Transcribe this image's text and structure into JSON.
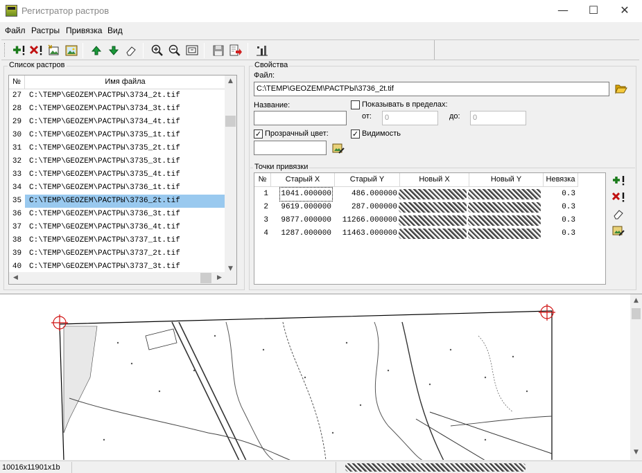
{
  "window": {
    "title": "Регистратор растров",
    "minimize_glyph": "—",
    "maximize_glyph": "☐",
    "close_glyph": "✕"
  },
  "menu": [
    "Файл",
    "Растры",
    "Привязка",
    "Вид"
  ],
  "toolbar": {
    "buttons": [
      {
        "name": "add-raster",
        "icon": "plus-exclaim-icon",
        "color": "#1a7a1a"
      },
      {
        "name": "remove-raster",
        "icon": "x-exclaim-icon",
        "color": "#c01010"
      },
      {
        "name": "open-raster",
        "icon": "image-open-icon"
      },
      {
        "name": "raster-image",
        "icon": "picture-icon"
      },
      {
        "name": "move-up",
        "icon": "arrow-up-icon",
        "color": "#1a9a3a"
      },
      {
        "name": "move-down",
        "icon": "arrow-down-icon",
        "color": "#1a9a3a"
      },
      {
        "name": "eraser",
        "icon": "eraser-icon"
      },
      {
        "name": "zoom-in",
        "icon": "zoom-in-icon"
      },
      {
        "name": "zoom-out",
        "icon": "zoom-out-icon"
      },
      {
        "name": "zoom-fit",
        "icon": "zoom-fit-icon"
      },
      {
        "name": "save",
        "icon": "floppy-icon"
      },
      {
        "name": "export",
        "icon": "export-icon",
        "color": "#d02020"
      },
      {
        "name": "tools",
        "icon": "tools-icon"
      }
    ]
  },
  "raster_list": {
    "group_label": "Список растров",
    "col_num": "№",
    "col_file": "Имя файла",
    "selected_index": 8,
    "rows": [
      {
        "num": "27",
        "file": "C:\\TEMP\\GEOZEM\\РАСТРЫ\\3734_2t.tif"
      },
      {
        "num": "28",
        "file": "C:\\TEMP\\GEOZEM\\РАСТРЫ\\3734_3t.tif"
      },
      {
        "num": "29",
        "file": "C:\\TEMP\\GEOZEM\\РАСТРЫ\\3734_4t.tif"
      },
      {
        "num": "30",
        "file": "C:\\TEMP\\GEOZEM\\РАСТРЫ\\3735_1t.tif"
      },
      {
        "num": "31",
        "file": "C:\\TEMP\\GEOZEM\\РАСТРЫ\\3735_2t.tif"
      },
      {
        "num": "32",
        "file": "C:\\TEMP\\GEOZEM\\РАСТРЫ\\3735_3t.tif"
      },
      {
        "num": "33",
        "file": "C:\\TEMP\\GEOZEM\\РАСТРЫ\\3735_4t.tif"
      },
      {
        "num": "34",
        "file": "C:\\TEMP\\GEOZEM\\РАСТРЫ\\3736_1t.tif"
      },
      {
        "num": "35",
        "file": "C:\\TEMP\\GEOZEM\\РАСТРЫ\\3736_2t.tif"
      },
      {
        "num": "36",
        "file": "C:\\TEMP\\GEOZEM\\РАСТРЫ\\3736_3t.tif"
      },
      {
        "num": "37",
        "file": "C:\\TEMP\\GEOZEM\\РАСТРЫ\\3736_4t.tif"
      },
      {
        "num": "38",
        "file": "C:\\TEMP\\GEOZEM\\РАСТРЫ\\3737_1t.tif"
      },
      {
        "num": "39",
        "file": "C:\\TEMP\\GEOZEM\\РАСТРЫ\\3737_2t.tif"
      },
      {
        "num": "40",
        "file": "C:\\TEMP\\GEOZEM\\РАСТРЫ\\3737_3t.tif"
      }
    ],
    "selection_color": "#99c9ef"
  },
  "properties": {
    "group_label": "Свойства",
    "file_label": "Файл:",
    "file_value": "C:\\TEMP\\GEOZEM\\РАСТРЫ\\3736_2t.tif",
    "name_label": "Название:",
    "name_value": "",
    "show_within_label": "Показывать в пределах:",
    "show_within_checked": false,
    "from_label": "от:",
    "from_value": "0",
    "to_label": "до:",
    "to_value": "0",
    "transparent_label": "Прозрачный цвет:",
    "transparent_checked": true,
    "transparent_value": "",
    "visibility_label": "Видимость",
    "visibility_checked": true
  },
  "tie_points": {
    "group_label": "Точки привязки",
    "columns": [
      "№",
      "Старый X",
      "Старый Y",
      "Новый X",
      "Новый Y",
      "Невязка"
    ],
    "rows": [
      {
        "num": "1",
        "old_x": "1041.000000",
        "old_y": "486.000000",
        "residual": "0.3"
      },
      {
        "num": "2",
        "old_x": "9619.000000",
        "old_y": "287.000000",
        "residual": "0.3"
      },
      {
        "num": "3",
        "old_x": "9877.000000",
        "old_y": "11266.000000",
        "residual": "0.3"
      },
      {
        "num": "4",
        "old_x": "1287.000000",
        "old_y": "11463.000000",
        "residual": "0.3"
      }
    ]
  },
  "status": {
    "raster_size": "10016x11901x1b"
  }
}
